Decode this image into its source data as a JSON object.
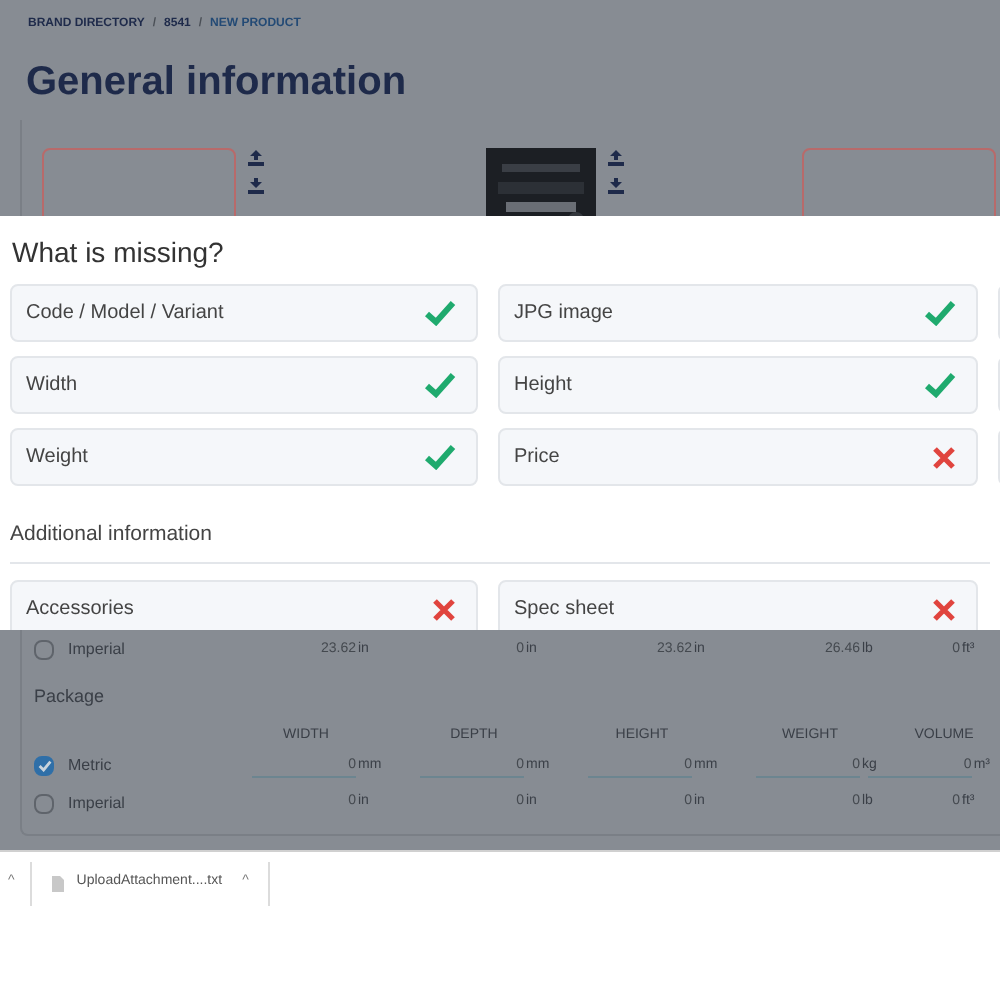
{
  "breadcrumb": [
    {
      "label": "BRAND DIRECTORY",
      "current": false
    },
    {
      "separator": "/",
      "label": "8541",
      "current": false
    },
    {
      "separator": "/",
      "label": "NEW PRODUCT",
      "current": true
    }
  ],
  "title": "General information",
  "modal": {
    "title": "What is missing?",
    "required": [
      {
        "label": "Code / Model / Variant",
        "complete": true
      },
      {
        "label": "JPG image",
        "complete": true
      },
      {
        "label": "Width",
        "complete": true
      },
      {
        "label": "Height",
        "complete": true
      },
      {
        "label": "Weight",
        "complete": true
      },
      {
        "label": "Price",
        "complete": false
      }
    ],
    "additional_title": "Additional information",
    "additional": [
      {
        "label": "Accessories",
        "complete": false
      },
      {
        "label": "Spec sheet",
        "complete": false
      }
    ]
  },
  "product_imperial": {
    "label": "Imperial",
    "checked": false,
    "cells": [
      {
        "value": "23.62",
        "unit": "in"
      },
      {
        "value": "0",
        "unit": "in"
      },
      {
        "value": "23.62",
        "unit": "in"
      },
      {
        "value": "26.46",
        "unit": "lb"
      },
      {
        "value": "0",
        "unit": "ft³"
      }
    ]
  },
  "package": {
    "title": "Package",
    "columns": [
      "WIDTH",
      "DEPTH",
      "HEIGHT",
      "WEIGHT",
      "VOLUME"
    ],
    "rows": [
      {
        "label": "Metric",
        "checked": true,
        "kind": "input",
        "cells": [
          {
            "placeholder": "0",
            "unit": "mm"
          },
          {
            "placeholder": "0",
            "unit": "mm"
          },
          {
            "placeholder": "0",
            "unit": "mm"
          },
          {
            "placeholder": "0",
            "unit": "kg"
          },
          {
            "placeholder": "0",
            "unit": "m³"
          }
        ]
      },
      {
        "label": "Imperial",
        "checked": false,
        "kind": "text",
        "cells": [
          {
            "value": "0",
            "unit": "in"
          },
          {
            "value": "0",
            "unit": "in"
          },
          {
            "value": "0",
            "unit": "in"
          },
          {
            "value": "0",
            "unit": "lb"
          },
          {
            "value": "0",
            "unit": "ft³"
          }
        ]
      }
    ]
  },
  "downloads": [
    {
      "arrow": "^"
    },
    {
      "file": "UploadAttachment....txt",
      "arrow": "^"
    }
  ]
}
